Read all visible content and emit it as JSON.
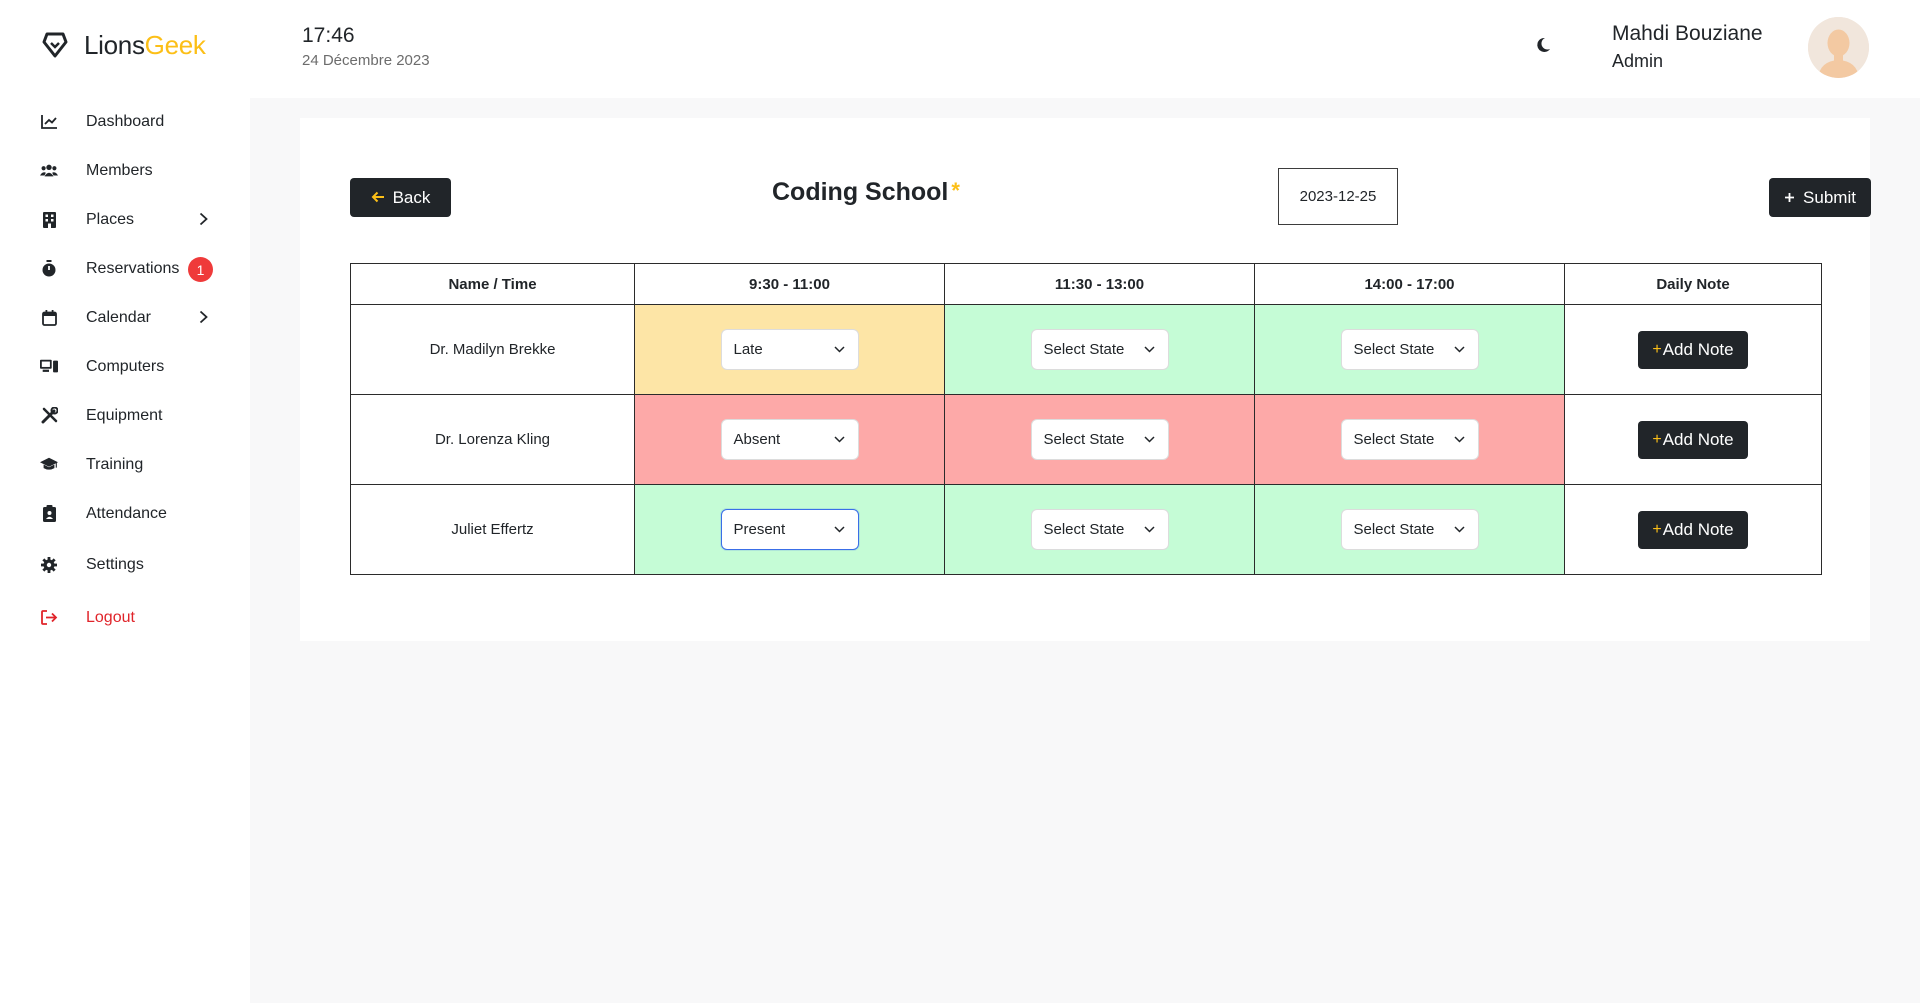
{
  "brand": {
    "name_part1": "Lions",
    "name_part2": "Geek",
    "accent_color": "#fcbf17"
  },
  "header": {
    "time": "17:46",
    "date": "24 Décembre 2023",
    "theme_icon": "moon-icon",
    "user": {
      "name": "Mahdi Bouziane",
      "role": "Admin"
    }
  },
  "sidebar": {
    "items": [
      {
        "label": "Dashboard",
        "icon": "chart-line-icon"
      },
      {
        "label": "Members",
        "icon": "users-icon"
      },
      {
        "label": "Places",
        "icon": "building-icon",
        "has_submenu": true
      },
      {
        "label": "Reservations",
        "icon": "stopwatch-icon",
        "badge": "1"
      },
      {
        "label": "Calendar",
        "icon": "calendar-icon",
        "has_submenu": true
      },
      {
        "label": "Computers",
        "icon": "computer-icon"
      },
      {
        "label": "Equipment",
        "icon": "tools-icon"
      },
      {
        "label": "Training",
        "icon": "graduation-cap-icon"
      },
      {
        "label": "Attendance",
        "icon": "clipboard-user-icon"
      },
      {
        "label": "Settings",
        "icon": "gear-icon"
      },
      {
        "label": "Logout",
        "icon": "logout-icon",
        "color": "#e0242a"
      }
    ]
  },
  "page": {
    "back_label": "Back",
    "title": "Coding School",
    "required_mark": "*",
    "date_value": "2023-12-25",
    "submit_label": "Submit"
  },
  "table": {
    "headers": [
      "Name / Time",
      "9:30 - 11:00",
      "11:30 - 13:00",
      "14:00 - 17:00",
      "Daily Note"
    ],
    "add_note_label": "Add Note",
    "state_colors": {
      "late": "#fde5a6",
      "present": "#c5fcd6",
      "absent": "#fda9a8"
    },
    "rows": [
      {
        "name": "Dr. Madilyn Brekke",
        "slots": [
          "Late",
          "Select State",
          "Select State"
        ]
      },
      {
        "name": "Dr. Lorenza Kling",
        "slots": [
          "Absent",
          "Select State",
          "Select State"
        ]
      },
      {
        "name": "Juliet Effertz",
        "slots": [
          "Present",
          "Select State",
          "Select State"
        ]
      }
    ]
  }
}
